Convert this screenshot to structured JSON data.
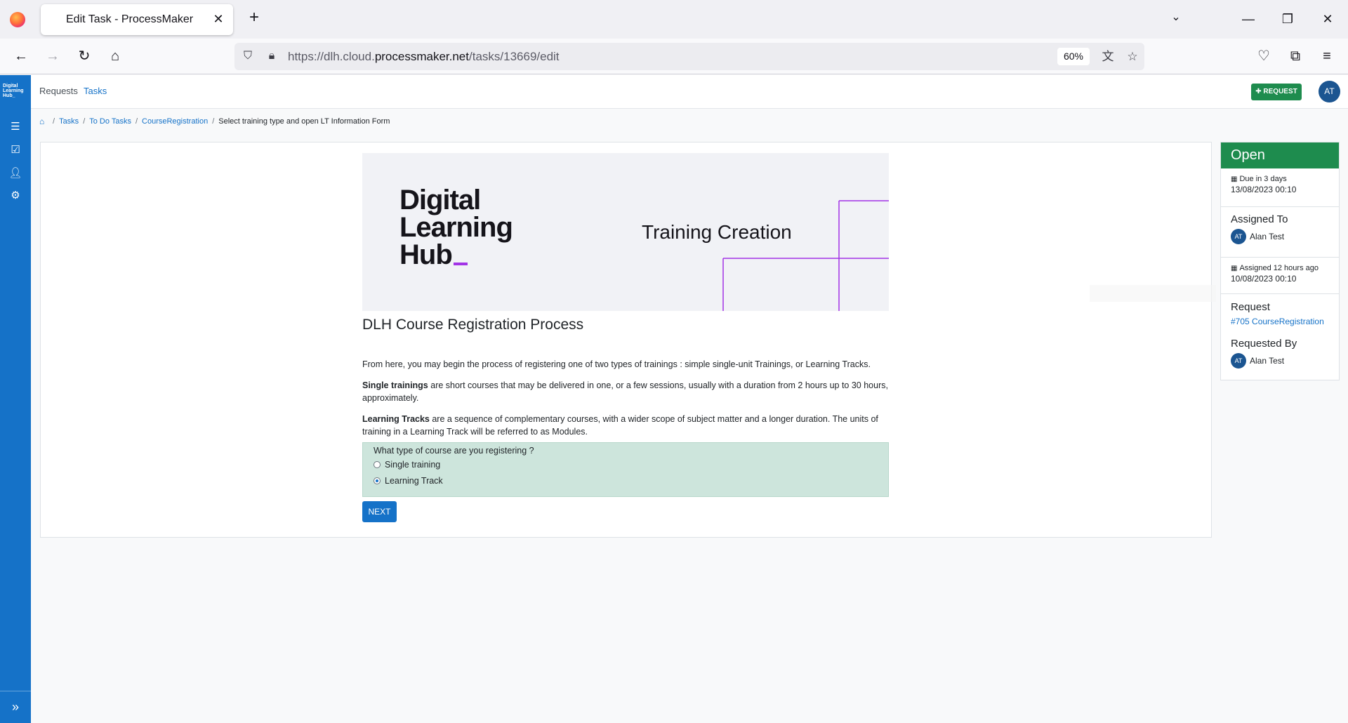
{
  "browser": {
    "tab_title": "Edit Task - ProcessMaker",
    "url_prefix": "https://dlh.cloud.",
    "url_host": "processmaker.net",
    "url_path": "/tasks/13669/edit",
    "zoom": "60%"
  },
  "app": {
    "sidebar_logo": "Digital Learning Hub_",
    "nav": {
      "requests": "Requests",
      "tasks": "Tasks"
    },
    "request_button": "REQUEST",
    "user_initials": "AT"
  },
  "breadcrumb": {
    "tasks": "Tasks",
    "todo": "To Do Tasks",
    "process": "CourseRegistration",
    "current": "Select training type and open LT Information Form"
  },
  "banner": {
    "logo_line1": "Digital",
    "logo_line2": "Learning",
    "logo_line3": "Hub",
    "title": "Training Creation"
  },
  "form": {
    "title": "DLH Course Registration Process",
    "intro": "From here, you may begin the process of registering one of two types of trainings : simple single-unit Trainings, or Learning Tracks.",
    "single_bold": "Single trainings",
    "single_text": " are short courses that may be delivered in one, or a few sessions, usually with a duration from 2 hours up to 30 hours, approximately.",
    "lt_bold": "Learning Tracks",
    "lt_text": " are a sequence of complementary courses, with a wider scope of subject matter and a longer duration. The units of training in a Learning Track will be referred to as Modules.",
    "question": "What type of course are you registering ?",
    "option1": "Single training",
    "option2": "Learning Track",
    "selected": "Learning Track",
    "next": "NEXT"
  },
  "panel": {
    "status": "Open",
    "due_label": "Due in 3 days",
    "due_date": "13/08/2023 00:10",
    "assigned_to_label": "Assigned To",
    "assignee": "Alan Test",
    "assignee_initials": "AT",
    "assigned_ago": "Assigned 12 hours ago",
    "assigned_date": "10/08/2023 00:10",
    "request_label": "Request",
    "request_link": "#705 CourseRegistration",
    "requested_by_label": "Requested By",
    "requester": "Alan Test",
    "requester_initials": "AT"
  },
  "colors": {
    "primary": "#1572c8",
    "success": "#1e8c4e",
    "radio_bg": "#cde5dc",
    "accent_purple": "#a233e6"
  }
}
